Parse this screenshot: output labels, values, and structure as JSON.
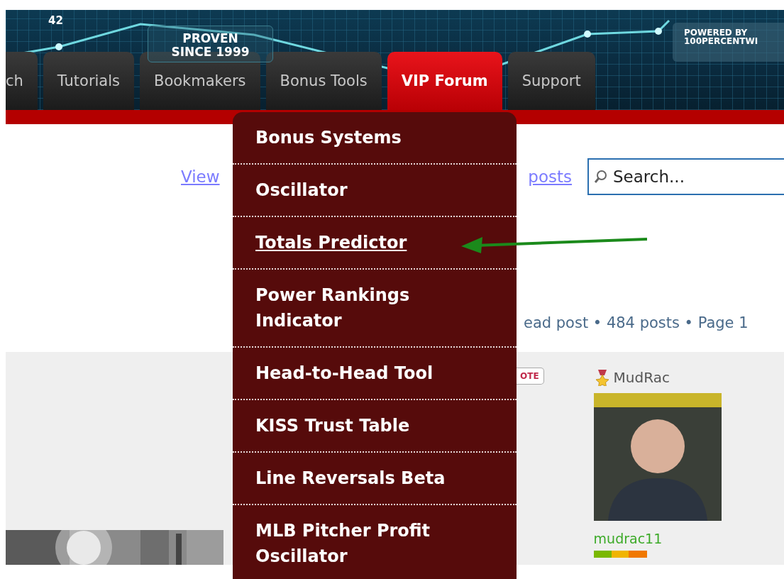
{
  "banner": {
    "badge": "42",
    "slogan": [
      "PROVEN",
      "SINCE 1999"
    ],
    "powered": [
      "POWERED BY",
      "100PERCENTWI"
    ]
  },
  "tabs": [
    {
      "label": "ch",
      "selected": false
    },
    {
      "label": "Tutorials",
      "selected": false
    },
    {
      "label": "Bookmakers",
      "selected": false
    },
    {
      "label": "Bonus Tools",
      "selected": false
    },
    {
      "label": "VIP Forum",
      "selected": true
    },
    {
      "label": "Support",
      "selected": false
    }
  ],
  "dropdown": {
    "items": [
      {
        "label": "Bonus Systems",
        "selected": false
      },
      {
        "label": "Oscillator",
        "selected": false
      },
      {
        "label": "Totals Predictor",
        "selected": true
      },
      {
        "label": "Power Rankings Indicator",
        "selected": false
      },
      {
        "label": "Head-to-Head Tool",
        "selected": false
      },
      {
        "label": "KISS Trust Table",
        "selected": false
      },
      {
        "label": "Line Reversals Beta",
        "selected": false
      },
      {
        "label": "MLB Pitcher Profit Oscillator",
        "selected": false
      }
    ]
  },
  "links": [
    "View",
    "posts"
  ],
  "search": {
    "placeholder": "Search..."
  },
  "topic_info": "ead post • 484 posts • Page 1",
  "post": {
    "quote_button": "OTE",
    "author": "MudRac",
    "username": "mudrac11"
  }
}
